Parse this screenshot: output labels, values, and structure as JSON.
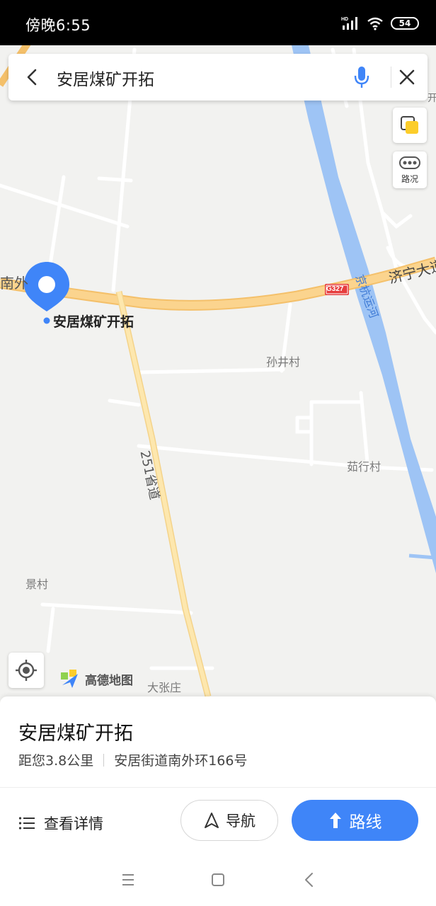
{
  "status_bar": {
    "time": "傍晚6:55",
    "battery": "54",
    "network_badge": "HD"
  },
  "search": {
    "query": "安居煤矿开拓"
  },
  "tools": {
    "traffic_label": "路况"
  },
  "map": {
    "labels": {
      "nanwai": "南外",
      "jining": "济宁大道",
      "g327": "G327",
      "jinghang": "京杭运河",
      "sunjing": "孙井村",
      "ruhang": "茹行村",
      "road251": "251省道",
      "jingcun": "景村",
      "dazhang": "大张庄",
      "edge_char": "开"
    },
    "marker_label": "安居煤矿开拓"
  },
  "logo": {
    "text": "高德地图"
  },
  "place": {
    "title": "安居煤矿开拓",
    "distance": "距您3.8公里",
    "address": "安居街道南外环166号"
  },
  "actions": {
    "details": "查看详情",
    "navigate": "导航",
    "route": "路线"
  },
  "colors": {
    "accent": "#3f85f8",
    "river": "#9ec4f5",
    "highway": "#f8c871"
  }
}
